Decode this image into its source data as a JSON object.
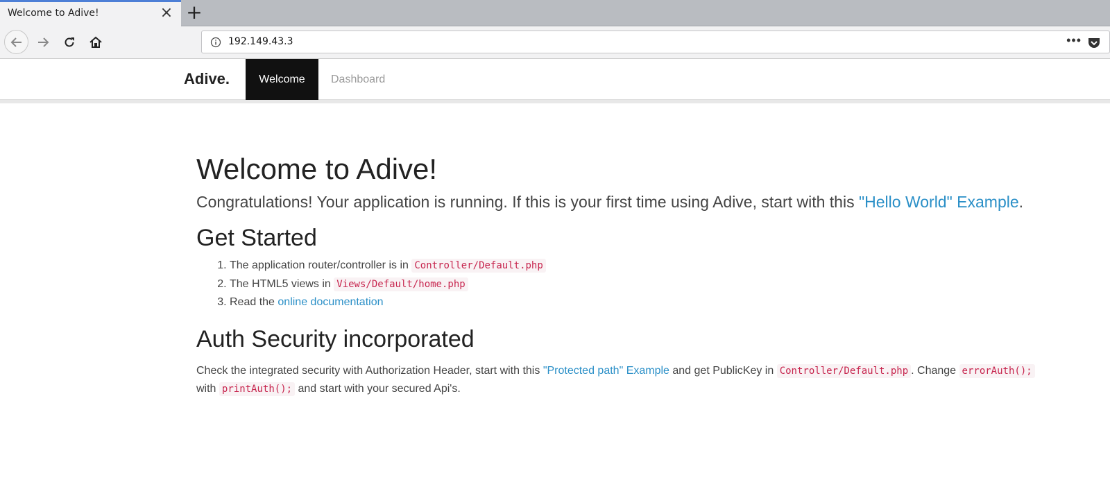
{
  "browser": {
    "tab_title": "Welcome to Adive!",
    "tab_close": "×",
    "new_tab": "+",
    "url": "192.149.43.3",
    "url_more": "•••"
  },
  "site_nav": {
    "brand": "Adive.",
    "items": [
      {
        "label": "Welcome",
        "active": true
      },
      {
        "label": "Dashboard",
        "active": false
      }
    ]
  },
  "main": {
    "title": "Welcome to Adive!",
    "lead_text": "Congratulations! Your application is running. If this is your first time using Adive, start with this ",
    "lead_link": "\"Hello World\" Example",
    "lead_end": ".",
    "get_started": {
      "heading": "Get Started",
      "items": [
        {
          "text": "The application router/controller is in ",
          "code": "Controller/Default.php"
        },
        {
          "text": "The HTML5 views in ",
          "code": "Views/Default/home.php"
        },
        {
          "text": "Read the ",
          "link": "online documentation"
        }
      ]
    },
    "auth": {
      "heading": "Auth Security incorporated",
      "text1": "Check the integrated security with Authorization Header, start with this ",
      "link": "\"Protected path\" Example",
      "text2": " and get PublicKey in ",
      "code1": "Controller/Default.php",
      "text3": ". Change ",
      "code2": "errorAuth();",
      "text4": " with ",
      "code3": "printAuth();",
      "text5": " and start with your secured Api's."
    }
  },
  "colors": {
    "link": "#2a8fc7",
    "code": "#c7254e",
    "active_nav_bg": "#111111",
    "tab_accent": "#4d7fd6"
  }
}
